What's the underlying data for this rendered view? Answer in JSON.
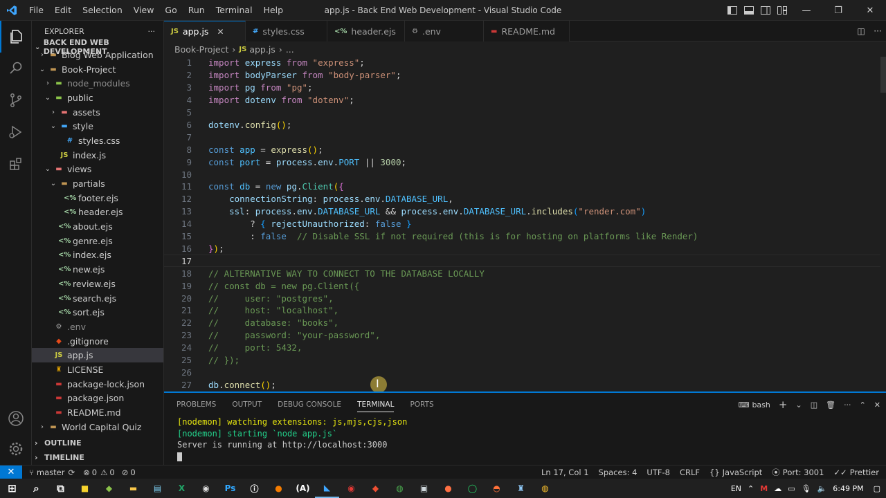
{
  "window": {
    "title": "app.js - Back End Web Development - Visual Studio Code",
    "menu": [
      "File",
      "Edit",
      "Selection",
      "View",
      "Go",
      "Run",
      "Terminal",
      "Help"
    ],
    "controls": {
      "minimize": "—",
      "maximize": "❐",
      "close": "✕"
    }
  },
  "explorer": {
    "title": "EXPLORER",
    "more": "···",
    "root": "BACK END WEB DEVELOPMENT",
    "items": [
      {
        "label": "Blog Web Application",
        "chev": "›",
        "icon": "▬",
        "color": "#c09553"
      },
      {
        "label": "Book-Project",
        "chev": "⌄",
        "icon": "▬",
        "color": "#c09553"
      },
      {
        "label": "node_modules",
        "chev": "›",
        "icon": "▬",
        "color": "#8bc34a",
        "dim": true
      },
      {
        "label": "public",
        "chev": "⌄",
        "icon": "▬",
        "color": "#8bc34a"
      },
      {
        "label": "assets",
        "chev": "›",
        "icon": "▬",
        "color": "#e57373"
      },
      {
        "label": "style",
        "chev": "⌄",
        "icon": "▬",
        "color": "#42a5f5"
      },
      {
        "label": "styles.css",
        "chev": "",
        "icon": "#",
        "color": "#42a5f5"
      },
      {
        "label": "index.js",
        "chev": "",
        "icon": "JS",
        "color": "#cbcb41"
      },
      {
        "label": "views",
        "chev": "⌄",
        "icon": "▬",
        "color": "#e57373"
      },
      {
        "label": "partials",
        "chev": "⌄",
        "icon": "▬",
        "color": "#c09553"
      },
      {
        "label": "footer.ejs",
        "chev": "",
        "icon": "<%",
        "color": "#a5d6a7"
      },
      {
        "label": "header.ejs",
        "chev": "",
        "icon": "<%",
        "color": "#a5d6a7"
      },
      {
        "label": "about.ejs",
        "chev": "",
        "icon": "<%",
        "color": "#a5d6a7"
      },
      {
        "label": "genre.ejs",
        "chev": "",
        "icon": "<%",
        "color": "#a5d6a7"
      },
      {
        "label": "index.ejs",
        "chev": "",
        "icon": "<%",
        "color": "#a5d6a7"
      },
      {
        "label": "new.ejs",
        "chev": "",
        "icon": "<%",
        "color": "#a5d6a7"
      },
      {
        "label": "review.ejs",
        "chev": "",
        "icon": "<%",
        "color": "#a5d6a7"
      },
      {
        "label": "search.ejs",
        "chev": "",
        "icon": "<%",
        "color": "#a5d6a7"
      },
      {
        "label": "sort.ejs",
        "chev": "",
        "icon": "<%",
        "color": "#a5d6a7"
      },
      {
        "label": ".env",
        "chev": "",
        "icon": "⚙",
        "color": "#9e9e9e",
        "dim": true
      },
      {
        "label": ".gitignore",
        "chev": "",
        "icon": "◆",
        "color": "#e64a19"
      },
      {
        "label": "app.js",
        "chev": "",
        "icon": "JS",
        "color": "#cbcb41",
        "selected": true
      },
      {
        "label": "LICENSE",
        "chev": "",
        "icon": "♜",
        "color": "#e0a100"
      },
      {
        "label": "package-lock.json",
        "chev": "",
        "icon": "▬",
        "color": "#cb3837"
      },
      {
        "label": "package.json",
        "chev": "",
        "icon": "▬",
        "color": "#cb3837"
      },
      {
        "label": "README.md",
        "chev": "",
        "icon": "▬",
        "color": "#cb3837"
      },
      {
        "label": "World Capital Quiz",
        "chev": "›",
        "icon": "▬",
        "color": "#c09553"
      }
    ],
    "outline": "OUTLINE",
    "timeline": "TIMELINE"
  },
  "tabs": [
    {
      "label": "app.js",
      "icon": "JS",
      "color": "#cbcb41",
      "active": true,
      "close": "✕"
    },
    {
      "label": "styles.css",
      "icon": "#",
      "color": "#42a5f5"
    },
    {
      "label": "header.ejs",
      "icon": "<%",
      "color": "#a5d6a7"
    },
    {
      "label": ".env",
      "icon": "⚙",
      "color": "#9e9e9e"
    },
    {
      "label": "README.md",
      "icon": "▬",
      "color": "#cb3837"
    }
  ],
  "breadcrumb": {
    "folder": "Book-Project",
    "file": "app.js",
    "icon": "JS",
    "sep": "›",
    "more": "..."
  },
  "editor": {
    "current_line": 17,
    "lines": [
      [
        [
          "kw",
          "import"
        ],
        [
          "pl",
          " "
        ],
        [
          "var",
          "express"
        ],
        [
          "pl",
          " "
        ],
        [
          "kw",
          "from"
        ],
        [
          "pl",
          " "
        ],
        [
          "str",
          "\"express\""
        ],
        [
          "pl",
          ";"
        ]
      ],
      [
        [
          "kw",
          "import"
        ],
        [
          "pl",
          " "
        ],
        [
          "var",
          "bodyParser"
        ],
        [
          "pl",
          " "
        ],
        [
          "kw",
          "from"
        ],
        [
          "pl",
          " "
        ],
        [
          "str",
          "\"body-parser\""
        ],
        [
          "pl",
          ";"
        ]
      ],
      [
        [
          "kw",
          "import"
        ],
        [
          "pl",
          " "
        ],
        [
          "var",
          "pg"
        ],
        [
          "pl",
          " "
        ],
        [
          "kw",
          "from"
        ],
        [
          "pl",
          " "
        ],
        [
          "str",
          "\"pg\""
        ],
        [
          "pl",
          ";"
        ]
      ],
      [
        [
          "kw",
          "import"
        ],
        [
          "pl",
          " "
        ],
        [
          "var",
          "dotenv"
        ],
        [
          "pl",
          " "
        ],
        [
          "kw",
          "from"
        ],
        [
          "pl",
          " "
        ],
        [
          "str",
          "\"dotenv\""
        ],
        [
          "pl",
          ";"
        ]
      ],
      [],
      [
        [
          "var",
          "dotenv"
        ],
        [
          "pl",
          "."
        ],
        [
          "fn",
          "config"
        ],
        [
          "br1",
          "()"
        ],
        [
          "pl",
          ";"
        ]
      ],
      [],
      [
        [
          "kb",
          "const"
        ],
        [
          "pl",
          " "
        ],
        [
          "con",
          "app"
        ],
        [
          "pl",
          " = "
        ],
        [
          "fn",
          "express"
        ],
        [
          "br1",
          "()"
        ],
        [
          "pl",
          ";"
        ]
      ],
      [
        [
          "kb",
          "const"
        ],
        [
          "pl",
          " "
        ],
        [
          "con",
          "port"
        ],
        [
          "pl",
          " = "
        ],
        [
          "var",
          "process"
        ],
        [
          "pl",
          "."
        ],
        [
          "var",
          "env"
        ],
        [
          "pl",
          "."
        ],
        [
          "con",
          "PORT"
        ],
        [
          "pl",
          " || "
        ],
        [
          "num",
          "3000"
        ],
        [
          "pl",
          ";"
        ]
      ],
      [],
      [
        [
          "kb",
          "const"
        ],
        [
          "pl",
          " "
        ],
        [
          "con",
          "db"
        ],
        [
          "pl",
          " = "
        ],
        [
          "kb",
          "new"
        ],
        [
          "pl",
          " "
        ],
        [
          "var",
          "pg"
        ],
        [
          "pl",
          "."
        ],
        [
          "cls",
          "Client"
        ],
        [
          "br1",
          "("
        ],
        [
          "br2",
          "{"
        ]
      ],
      [
        [
          "pl",
          "    "
        ],
        [
          "var",
          "connectionString"
        ],
        [
          "pl",
          ": "
        ],
        [
          "var",
          "process"
        ],
        [
          "pl",
          "."
        ],
        [
          "var",
          "env"
        ],
        [
          "pl",
          "."
        ],
        [
          "con",
          "DATABASE_URL"
        ],
        [
          "pl",
          ","
        ]
      ],
      [
        [
          "pl",
          "    "
        ],
        [
          "var",
          "ssl"
        ],
        [
          "pl",
          ": "
        ],
        [
          "var",
          "process"
        ],
        [
          "pl",
          "."
        ],
        [
          "var",
          "env"
        ],
        [
          "pl",
          "."
        ],
        [
          "con",
          "DATABASE_URL"
        ],
        [
          "pl",
          " && "
        ],
        [
          "var",
          "process"
        ],
        [
          "pl",
          "."
        ],
        [
          "var",
          "env"
        ],
        [
          "pl",
          "."
        ],
        [
          "con",
          "DATABASE_URL"
        ],
        [
          "pl",
          "."
        ],
        [
          "fn",
          "includes"
        ],
        [
          "br3",
          "("
        ],
        [
          "str",
          "\"render.com\""
        ],
        [
          "br3",
          ")"
        ]
      ],
      [
        [
          "pl",
          "        ? "
        ],
        [
          "br3",
          "{"
        ],
        [
          "pl",
          " "
        ],
        [
          "var",
          "rejectUnauthorized"
        ],
        [
          "pl",
          ": "
        ],
        [
          "kb",
          "false"
        ],
        [
          "pl",
          " "
        ],
        [
          "br3",
          "}"
        ]
      ],
      [
        [
          "pl",
          "        : "
        ],
        [
          "kb",
          "false"
        ],
        [
          "pl",
          "  "
        ],
        [
          "cm",
          "// Disable SSL if not required (this is for hosting on platforms like Render)"
        ]
      ],
      [
        [
          "br2",
          "}"
        ],
        [
          "br1",
          ")"
        ],
        [
          "pl",
          ";"
        ]
      ],
      [],
      [
        [
          "cm",
          "// ALTERNATIVE WAY TO CONNECT TO THE DATABASE LOCALLY"
        ]
      ],
      [
        [
          "cm",
          "// const db = new pg.Client({"
        ]
      ],
      [
        [
          "cm",
          "//     user: \"postgres\","
        ]
      ],
      [
        [
          "cm",
          "//     host: \"localhost\","
        ]
      ],
      [
        [
          "cm",
          "//     database: \"books\","
        ]
      ],
      [
        [
          "cm",
          "//     password: \"your-password\","
        ]
      ],
      [
        [
          "cm",
          "//     port: 5432,"
        ]
      ],
      [
        [
          "cm",
          "// });"
        ]
      ],
      [],
      [
        [
          "var",
          "db"
        ],
        [
          "pl",
          "."
        ],
        [
          "fn",
          "connect"
        ],
        [
          "br1",
          "()"
        ],
        [
          "pl",
          ";"
        ]
      ]
    ]
  },
  "panel": {
    "tabs": [
      {
        "label": "PROBLEMS"
      },
      {
        "label": "OUTPUT"
      },
      {
        "label": "DEBUG CONSOLE"
      },
      {
        "label": "TERMINAL",
        "active": true
      },
      {
        "label": "PORTS"
      }
    ],
    "shell": "bash",
    "terminal": {
      "line1": "[nodemon] watching extensions: js,mjs,cjs,json",
      "line2": "[nodemon] starting `node app.js`",
      "line3": "Server is running at http://localhost:3000"
    }
  },
  "status": {
    "remote_icon": "⚡",
    "branch": "master",
    "sync": "⟳",
    "errors": "0",
    "warnings": "0",
    "ports": "0",
    "position": "Ln 17, Col 1",
    "spaces": "Spaces: 4",
    "encoding": "UTF-8",
    "eol": "CRLF",
    "language": "JavaScript",
    "port": "Port: 3001",
    "formatter": "Prettier"
  },
  "taskbar": {
    "apps": [
      {
        "name": "start",
        "glyph": "⊞",
        "color": "#ffffff"
      },
      {
        "name": "search",
        "glyph": "⌕",
        "color": "#ffffff"
      },
      {
        "name": "task-view",
        "glyph": "⧉",
        "color": "#ffffff"
      },
      {
        "name": "sticky-notes",
        "glyph": "■",
        "color": "#f6d32d"
      },
      {
        "name": "app-green",
        "glyph": "◆",
        "color": "#8bc34a"
      },
      {
        "name": "file-explorer",
        "glyph": "▬",
        "color": "#f8c74a"
      },
      {
        "name": "notepad",
        "glyph": "▤",
        "color": "#7fd3f7"
      },
      {
        "name": "excel",
        "glyph": "X",
        "color": "#21a366"
      },
      {
        "name": "obs",
        "glyph": "◉",
        "color": "#dddddd"
      },
      {
        "name": "photoshop",
        "glyph": "Ps",
        "color": "#31a8ff"
      },
      {
        "name": "app-i",
        "glyph": "ⓘ",
        "color": "#ffffff"
      },
      {
        "name": "app-orange",
        "glyph": "●",
        "color": "#f57c00"
      },
      {
        "name": "app-a",
        "glyph": "(A)",
        "color": "#ffffff"
      },
      {
        "name": "vscode",
        "glyph": "◣",
        "color": "#3ea6ff",
        "active": true
      },
      {
        "name": "recorder",
        "glyph": "◉",
        "color": "#e53935"
      },
      {
        "name": "git",
        "glyph": "◆",
        "color": "#f05033"
      },
      {
        "name": "chrome",
        "glyph": "◍",
        "color": "#4caf50"
      },
      {
        "name": "app-monitor",
        "glyph": "▣",
        "color": "#cfd8dc"
      },
      {
        "name": "app-orange-2",
        "glyph": "●",
        "color": "#ff7043"
      },
      {
        "name": "whatsapp",
        "glyph": "◯",
        "color": "#25d366"
      },
      {
        "name": "firefox",
        "glyph": "◓",
        "color": "#ff7139"
      },
      {
        "name": "app-robot",
        "glyph": "♜",
        "color": "#90caf9"
      },
      {
        "name": "chrome-2",
        "glyph": "◍",
        "color": "#fbc02d"
      }
    ],
    "lang": "EN",
    "time": "6:49 PM"
  }
}
